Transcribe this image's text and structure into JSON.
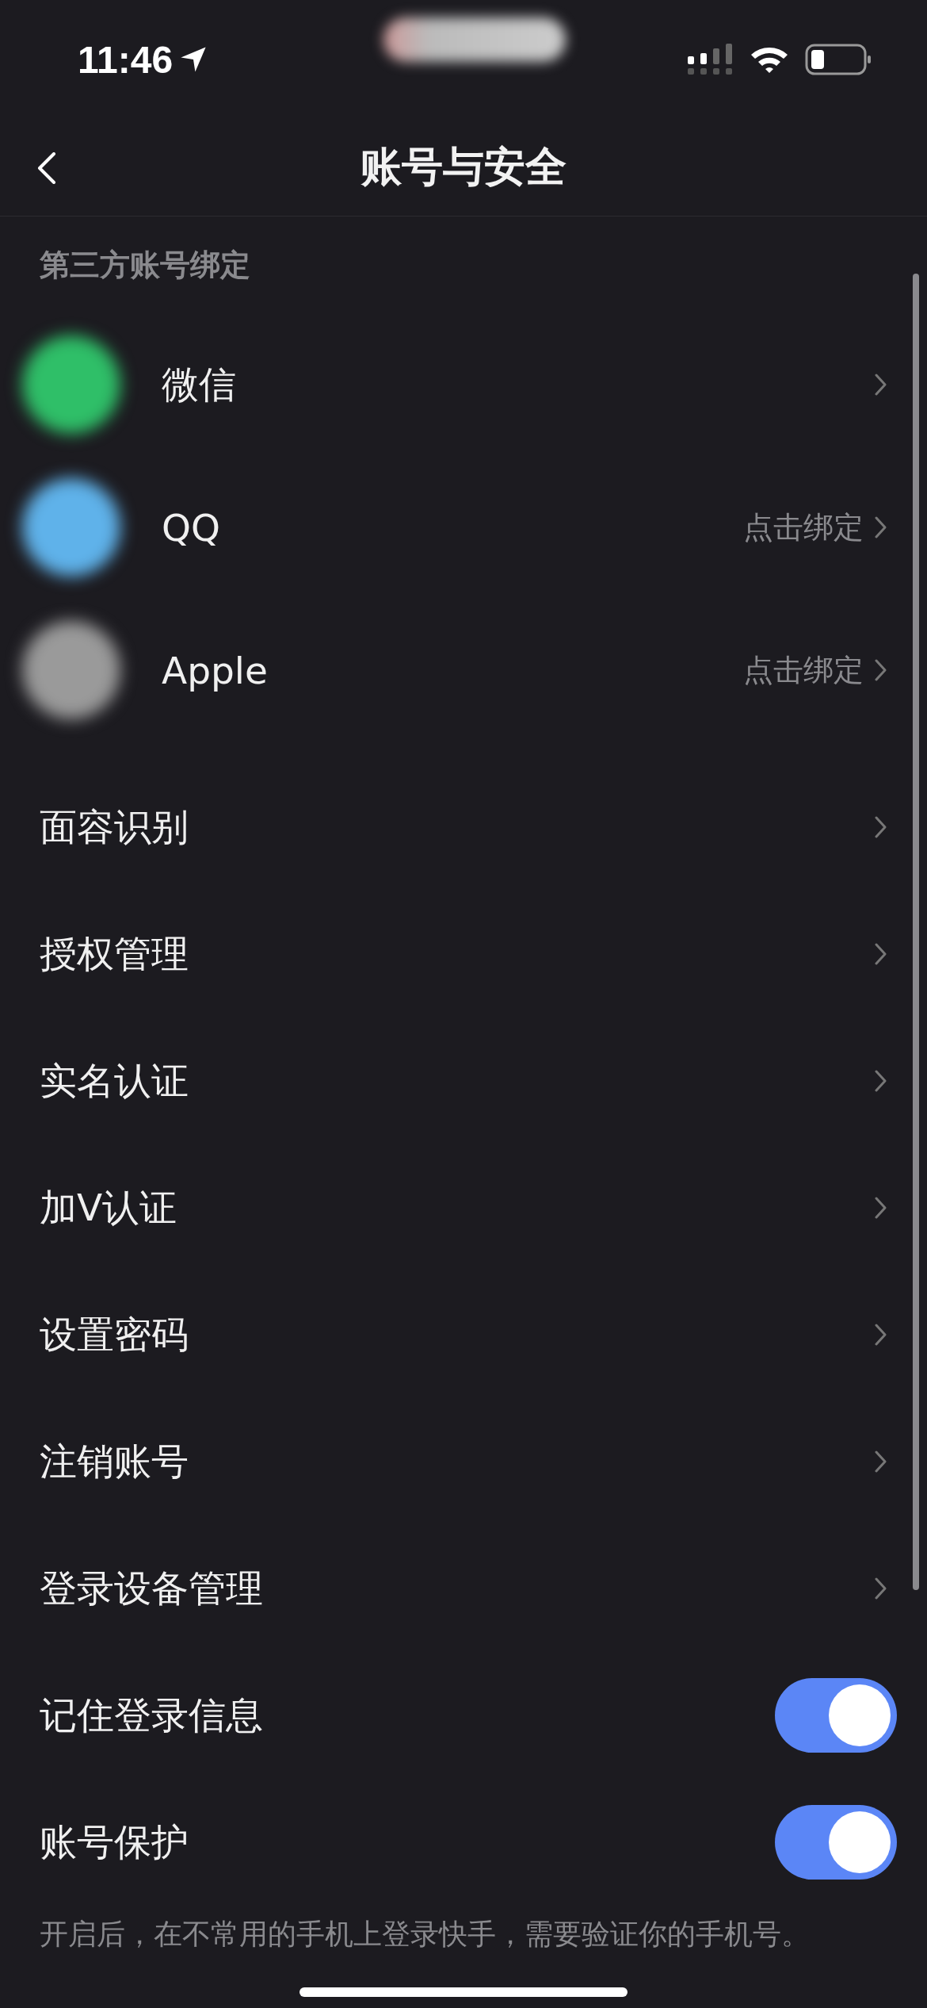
{
  "status_bar": {
    "time": "11:46"
  },
  "nav": {
    "title": "账号与安全"
  },
  "third_party": {
    "header": "第三方账号绑定",
    "items": [
      {
        "label": "微信",
        "color": "#2fbf68"
      },
      {
        "label": "QQ",
        "color": "#5fb2ea",
        "action": "点击绑定"
      },
      {
        "label": "Apple",
        "color": "#9a9a9a",
        "action": "点击绑定"
      }
    ]
  },
  "settings": [
    {
      "kind": "link",
      "label": "面容识别"
    },
    {
      "kind": "link",
      "label": "授权管理"
    },
    {
      "kind": "link",
      "label": "实名认证"
    },
    {
      "kind": "link",
      "label": "加V认证"
    },
    {
      "kind": "link",
      "label": "设置密码"
    },
    {
      "kind": "link",
      "label": "注销账号"
    },
    {
      "kind": "link",
      "label": "登录设备管理"
    },
    {
      "kind": "toggle",
      "label": "记住登录信息",
      "on": true
    },
    {
      "kind": "toggle",
      "label": "账号保护",
      "on": true
    }
  ],
  "footer_note": "开启后，在不常用的手机上登录快手，需要验证你的手机号。"
}
